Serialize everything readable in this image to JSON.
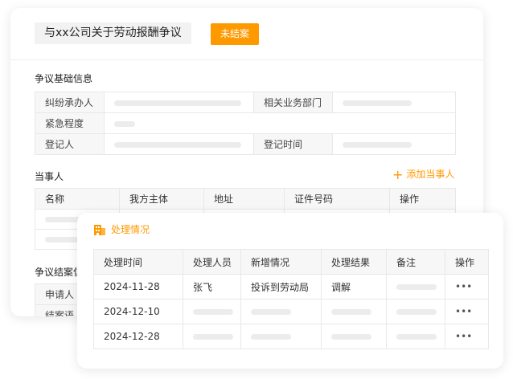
{
  "header": {
    "title": "与xx公司关于劳动报酬争议",
    "status": "未结案"
  },
  "basic_info": {
    "title": "争议基础信息",
    "rows": [
      {
        "label1": "纠纷承办人",
        "label2": "相关业务部门"
      },
      {
        "label1": "紧急程度"
      },
      {
        "label1": "登记人",
        "label2": "登记时间"
      }
    ]
  },
  "parties": {
    "title": "当事人",
    "add_label": "添加当事人",
    "columns": [
      "名称",
      "我方主体",
      "地址",
      "证件号码",
      "操作"
    ]
  },
  "settlement": {
    "title": "争议结案信",
    "rows": [
      "申请人",
      "结案语"
    ]
  },
  "processing": {
    "title": "处理情况",
    "columns": [
      "处理时间",
      "处理人员",
      "新增情况",
      "处理结果",
      "备注",
      "操作"
    ],
    "rows": [
      {
        "time": "2024-11-28",
        "person": "张飞",
        "situation": "投诉到劳动局",
        "result": "调解",
        "action": "•••"
      },
      {
        "time": "2024-12-10",
        "action": "•••"
      },
      {
        "time": "2024-12-28",
        "action": "•••"
      }
    ]
  },
  "colors": {
    "accent": "#ff9900",
    "label_bg": "#f7f7f7",
    "placeholder": "#ececec"
  },
  "icons": {
    "processing": "building-icon",
    "add": "plus-icon",
    "more": "more-icon"
  }
}
